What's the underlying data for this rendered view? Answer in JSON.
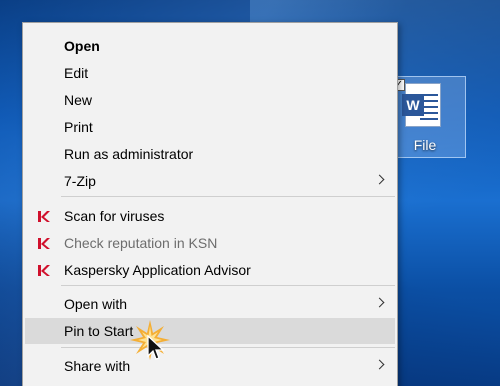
{
  "desktop": {
    "file_icon": {
      "label": "File",
      "icon": "word-document-icon"
    }
  },
  "context_menu": {
    "items": [
      {
        "label": "Open",
        "default": true
      },
      {
        "label": "Edit"
      },
      {
        "label": "New"
      },
      {
        "label": "Print"
      },
      {
        "label": "Run as administrator"
      },
      {
        "label": "7-Zip",
        "submenu": true
      },
      {
        "label": "Scan for viruses",
        "icon": "kaspersky-icon"
      },
      {
        "label": "Check reputation in KSN",
        "icon": "kaspersky-icon",
        "disabled": true
      },
      {
        "label": "Kaspersky Application Advisor",
        "icon": "kaspersky-icon"
      },
      {
        "label": "Open with",
        "submenu": true
      },
      {
        "label": "Pin to Start",
        "highlighted": true
      },
      {
        "label": "Share with",
        "submenu": true
      }
    ]
  },
  "colors": {
    "menu_background": "#f2f2f2",
    "highlight": "#dadada",
    "disabled_text": "#6d6d6d",
    "kaspersky_red": "#d0102c",
    "desktop_blue": "#0d57b3"
  }
}
